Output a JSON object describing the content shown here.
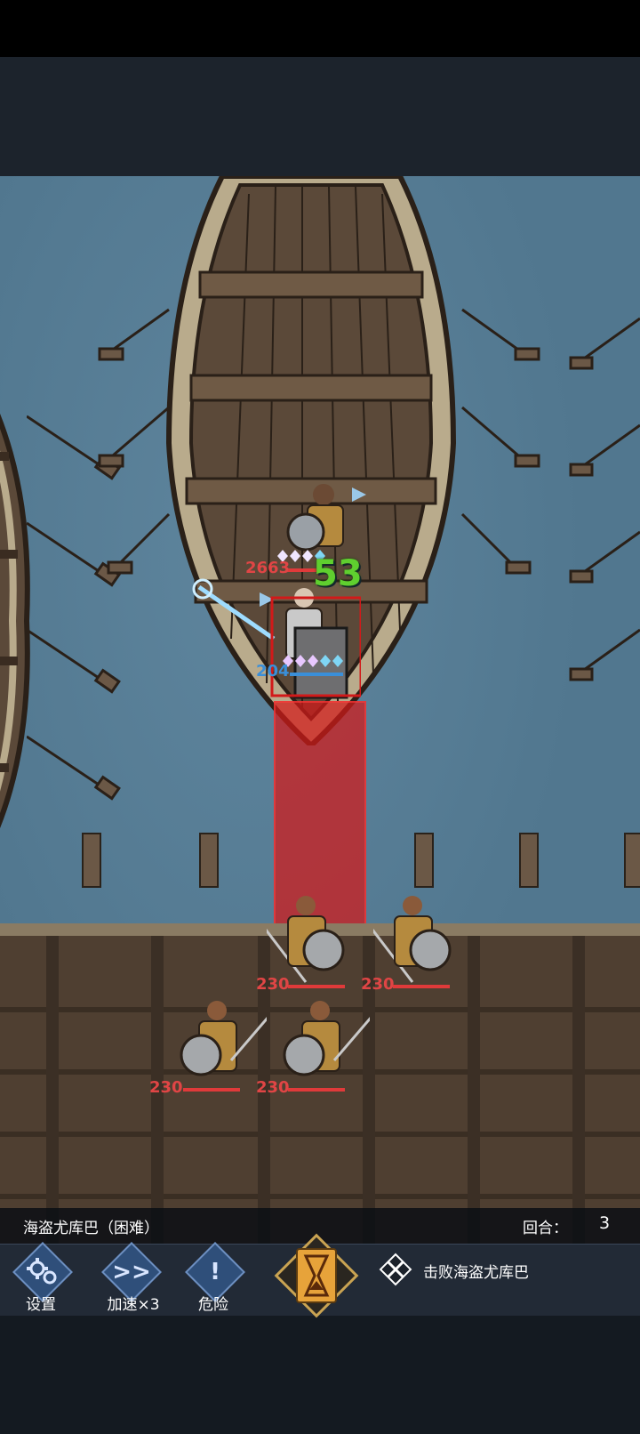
{
  "stage": {
    "title": "海盗尤库巴（困难）",
    "round_label": "回合：",
    "round_value": "3"
  },
  "controls": {
    "settings_label": "设置",
    "speed_label": "加速×3",
    "danger_label": "危险",
    "speed_icon": ">>",
    "danger_icon": "!"
  },
  "objective": {
    "text": "击败海盗尤库巴"
  },
  "combat": {
    "enemy_boss_hp": "2663",
    "damage_popup": "53",
    "player_hp": "204",
    "ally_hp": [
      "230",
      "230",
      "230",
      "230"
    ]
  },
  "colors": {
    "water": "#51778f",
    "enemy_hp": "#e03a3a",
    "player_hp": "#3a8fd9",
    "damage": "#5fcf2f",
    "danger_zone": "#d21919"
  }
}
